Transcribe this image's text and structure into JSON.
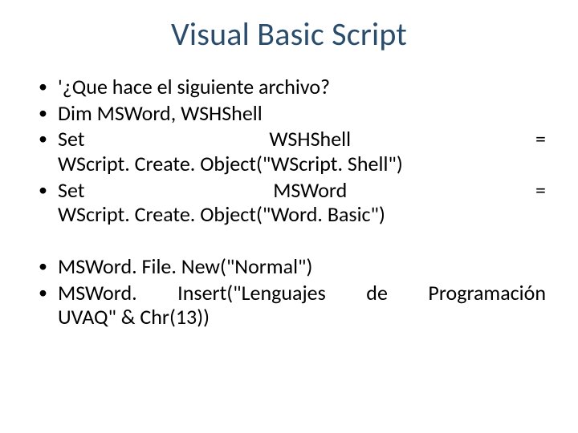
{
  "title": "Visual Basic Script",
  "bullets": {
    "b1": "'¿Que hace el siguiente archivo?",
    "b2": "Dim MSWord, WSHShell",
    "b3_line1": "Set WSHShell =",
    "b3_line2": "WScript. Create. Object(\"WScript. Shell\")",
    "b4_line1": "Set MSWord =",
    "b4_line2": "WScript. Create. Object(\"Word. Basic\")",
    "b5": "MSWord. File. New(\"Normal\")",
    "b6_line1": "MSWord. Insert(\"Lenguajes de Programación",
    "b6_line2": "UVAQ\" & Chr(13))"
  }
}
